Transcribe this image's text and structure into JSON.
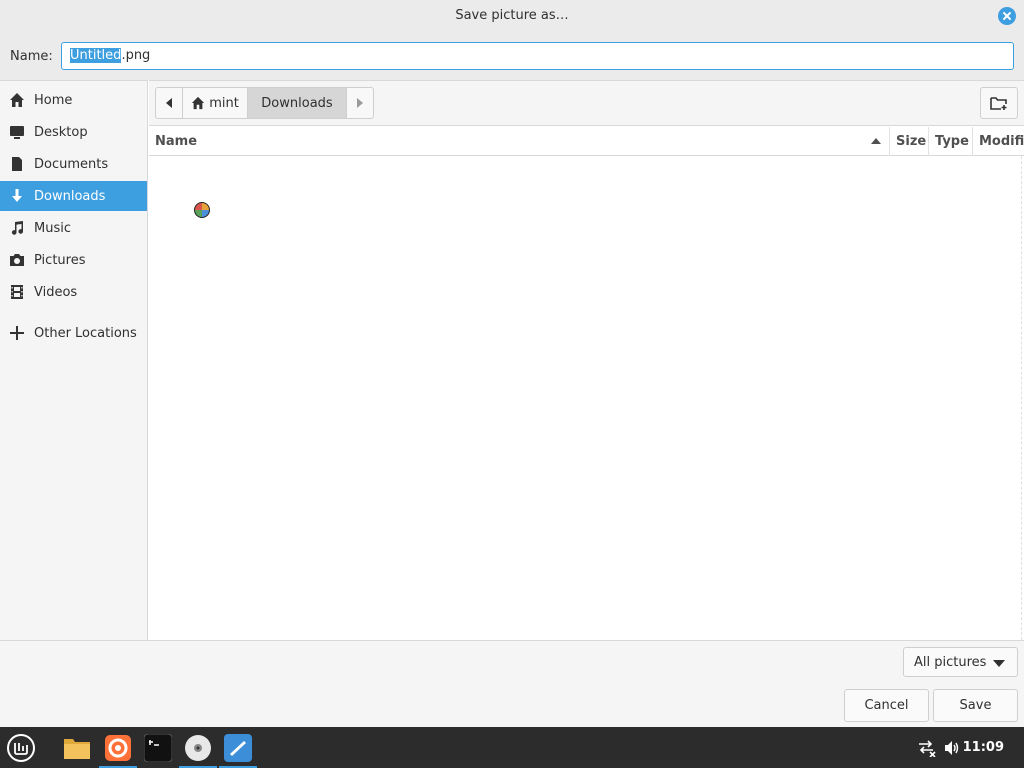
{
  "window": {
    "title": "Save picture as…"
  },
  "name_field": {
    "label": "Name:",
    "selected_part": "Untitled",
    "rest": ".png"
  },
  "sidebar": {
    "items": [
      {
        "label": "Home",
        "icon": "home-icon"
      },
      {
        "label": "Desktop",
        "icon": "desktop-icon"
      },
      {
        "label": "Documents",
        "icon": "documents-icon"
      },
      {
        "label": "Downloads",
        "icon": "download-icon",
        "active": true
      },
      {
        "label": "Music",
        "icon": "music-icon"
      },
      {
        "label": "Pictures",
        "icon": "camera-icon"
      },
      {
        "label": "Videos",
        "icon": "film-icon"
      },
      {
        "label": "Other Locations",
        "icon": "plus-icon"
      }
    ]
  },
  "pathbar": {
    "home": "mint",
    "current": "Downloads"
  },
  "file_list": {
    "columns": [
      "Name",
      "Size",
      "Type",
      "Modified"
    ],
    "sort_column": "Name",
    "rows": []
  },
  "footer": {
    "filter": "All pictures",
    "cancel": "Cancel",
    "save": "Save"
  },
  "taskbar": {
    "clock": "11:09",
    "apps": [
      "menu-icon",
      "files-icon",
      "firefox-icon",
      "terminal-icon",
      "disc-icon",
      "editor-icon"
    ]
  },
  "colors": {
    "accent": "#3d9ee0",
    "taskbar": "#2c2c2c"
  }
}
